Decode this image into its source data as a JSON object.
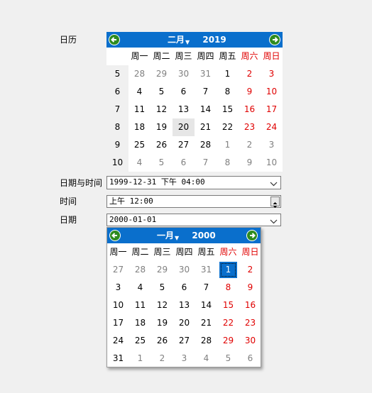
{
  "labels": {
    "calendar": "日历",
    "datetime": "日期与时间",
    "time": "时间",
    "date": "日期"
  },
  "weekdays": [
    "周一",
    "周二",
    "周三",
    "周四",
    "周五",
    "周六",
    "周日"
  ],
  "calendar1": {
    "month": "二月",
    "year": "2019",
    "week_numbers": [
      "5",
      "6",
      "7",
      "8",
      "9",
      "10"
    ],
    "days": [
      [
        "28",
        "29",
        "30",
        "31",
        "1",
        "2",
        "3"
      ],
      [
        "4",
        "5",
        "6",
        "7",
        "8",
        "9",
        "10"
      ],
      [
        "11",
        "12",
        "13",
        "14",
        "15",
        "16",
        "17"
      ],
      [
        "18",
        "19",
        "20",
        "21",
        "22",
        "23",
        "24"
      ],
      [
        "25",
        "26",
        "27",
        "28",
        "1",
        "2",
        "3"
      ],
      [
        "4",
        "5",
        "6",
        "7",
        "8",
        "9",
        "10"
      ]
    ]
  },
  "datetime_field": {
    "value": "1999-12-31 下午 04:00"
  },
  "time_field": {
    "value": "上午 12:00"
  },
  "date_field": {
    "value": "2000-01-01"
  },
  "calendar2": {
    "month": "一月",
    "year": "2000",
    "days": [
      [
        "27",
        "28",
        "29",
        "30",
        "31",
        "1",
        "2"
      ],
      [
        "3",
        "4",
        "5",
        "6",
        "7",
        "8",
        "9"
      ],
      [
        "10",
        "11",
        "12",
        "13",
        "14",
        "15",
        "16"
      ],
      [
        "17",
        "18",
        "19",
        "20",
        "21",
        "22",
        "23"
      ],
      [
        "24",
        "25",
        "26",
        "27",
        "28",
        "29",
        "30"
      ],
      [
        "31",
        "1",
        "2",
        "3",
        "4",
        "5",
        "6"
      ]
    ]
  },
  "colors": {
    "header": "#0a6fcc",
    "weekend": "#e00000",
    "muted": "#808080",
    "selected": "#0a6fcc",
    "nav_arrow": "#2e8b1e"
  },
  "icons": {
    "prev": "arrow-left-icon",
    "next": "arrow-right-icon",
    "dropdown": "chevron-down-icon"
  }
}
